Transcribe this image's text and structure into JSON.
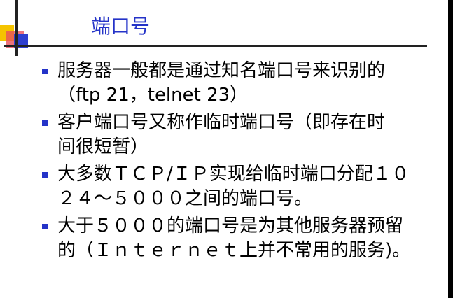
{
  "slide": {
    "title": "端口号",
    "bullets": [
      {
        "lines": [
          "服务器一般都是通过知名端口号来识别的",
          "（ftp 21，telnet 23）"
        ]
      },
      {
        "lines": [
          "客户端口号又称作临时端口号（即存在时",
          "间很短暂）"
        ]
      },
      {
        "lines": [
          "大多数ＴＣＰ/ＩＰ实现给临时端口分配１０",
          "２４～５０００之间的端口号。"
        ]
      },
      {
        "lines": [
          "大于５０００的端口号是为其他服务器预留",
          "的（Ｉｎｔｅｒｎｅｔ上并不常用的服务)。"
        ]
      }
    ]
  },
  "colors": {
    "title": "#2433c8",
    "bullet_marker": "#2433c8",
    "text": "#000000"
  }
}
